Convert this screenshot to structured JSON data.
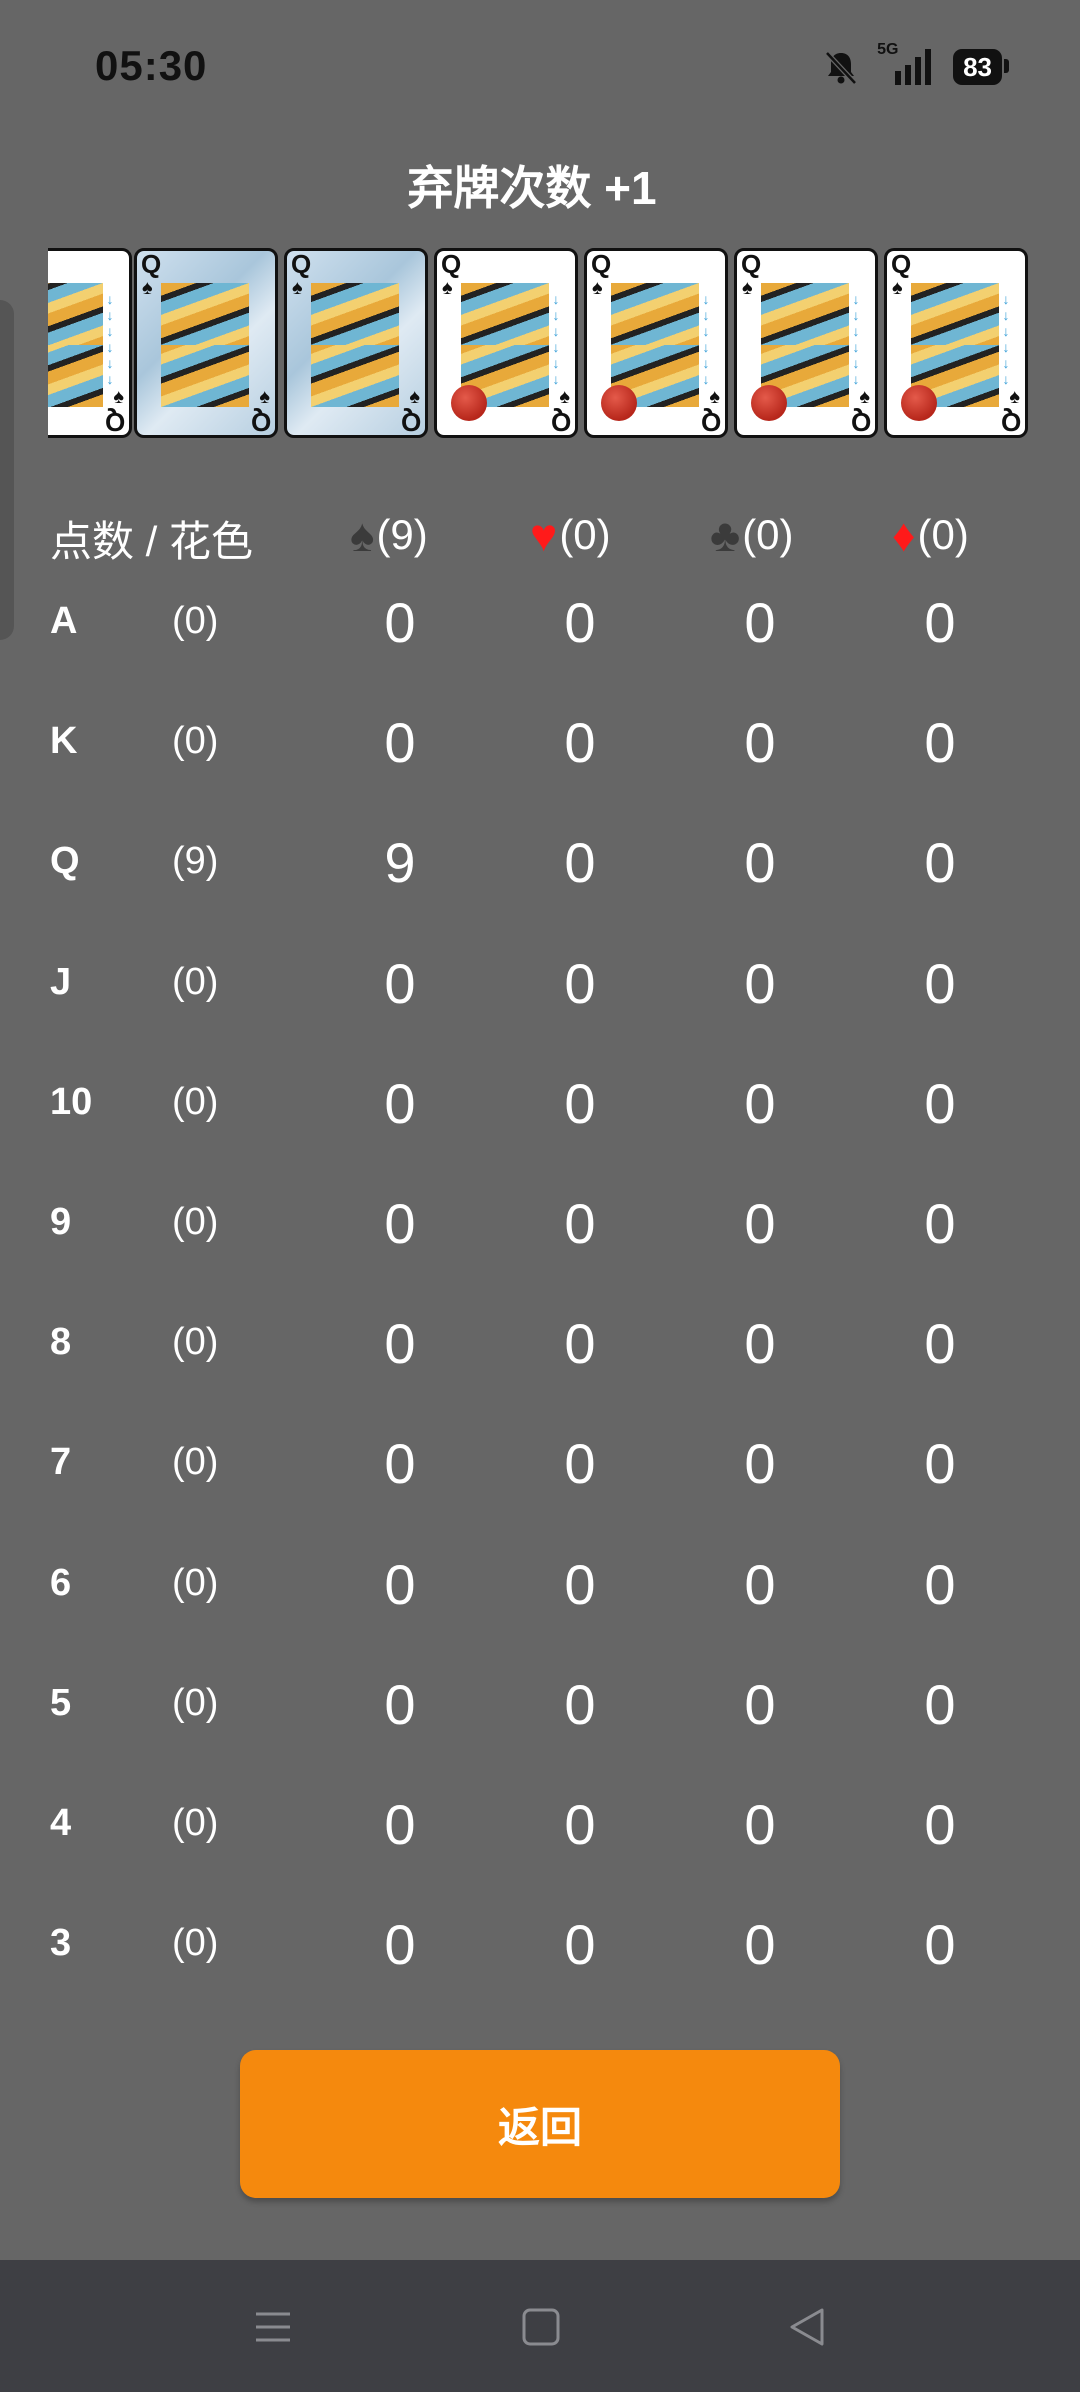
{
  "status_bar": {
    "time": "05:30",
    "network": "5G",
    "battery": "83",
    "icons": [
      "bell-muted-icon",
      "signal-5g-icon",
      "battery-icon"
    ]
  },
  "title": "弃牌次数 +1",
  "cards": [
    {
      "rank": "Q",
      "suit": "♠",
      "style": "face-partial"
    },
    {
      "rank": "Q",
      "suit": "♠",
      "style": "back"
    },
    {
      "rank": "Q",
      "suit": "♠",
      "style": "back"
    },
    {
      "rank": "Q",
      "suit": "♠",
      "style": "face"
    },
    {
      "rank": "Q",
      "suit": "♠",
      "style": "face"
    },
    {
      "rank": "Q",
      "suit": "♠",
      "style": "face"
    },
    {
      "rank": "Q",
      "suit": "♠",
      "style": "face"
    }
  ],
  "table": {
    "header_title": "点数 / 花色",
    "suits": [
      {
        "glyph": "♠",
        "name": "spade",
        "count": "(9)",
        "color": "#3b3b3b"
      },
      {
        "glyph": "♥",
        "name": "heart",
        "count": "(0)",
        "color": "#ff1a1a"
      },
      {
        "glyph": "♣",
        "name": "club",
        "count": "(0)",
        "color": "#3b3b3b"
      },
      {
        "glyph": "♦",
        "name": "diamond",
        "count": "(0)",
        "color": "#ff1a1a"
      }
    ],
    "rows": [
      {
        "rank": "A",
        "total": "(0)",
        "values": [
          "0",
          "0",
          "0",
          "0"
        ]
      },
      {
        "rank": "K",
        "total": "(0)",
        "values": [
          "0",
          "0",
          "0",
          "0"
        ]
      },
      {
        "rank": "Q",
        "total": "(9)",
        "values": [
          "9",
          "0",
          "0",
          "0"
        ]
      },
      {
        "rank": "J",
        "total": "(0)",
        "values": [
          "0",
          "0",
          "0",
          "0"
        ]
      },
      {
        "rank": "10",
        "total": "(0)",
        "values": [
          "0",
          "0",
          "0",
          "0"
        ]
      },
      {
        "rank": "9",
        "total": "(0)",
        "values": [
          "0",
          "0",
          "0",
          "0"
        ]
      },
      {
        "rank": "8",
        "total": "(0)",
        "values": [
          "0",
          "0",
          "0",
          "0"
        ]
      },
      {
        "rank": "7",
        "total": "(0)",
        "values": [
          "0",
          "0",
          "0",
          "0"
        ]
      },
      {
        "rank": "6",
        "total": "(0)",
        "values": [
          "0",
          "0",
          "0",
          "0"
        ]
      },
      {
        "rank": "5",
        "total": "(0)",
        "values": [
          "0",
          "0",
          "0",
          "0"
        ]
      },
      {
        "rank": "4",
        "total": "(0)",
        "values": [
          "0",
          "0",
          "0",
          "0"
        ]
      },
      {
        "rank": "3",
        "total": "(0)",
        "values": [
          "0",
          "0",
          "0",
          "0"
        ]
      }
    ]
  },
  "return_button": {
    "label": "返回",
    "color": "#f5890d"
  },
  "nav": {
    "items": [
      "menu-icon",
      "home-square-icon",
      "back-triangle-icon"
    ]
  }
}
